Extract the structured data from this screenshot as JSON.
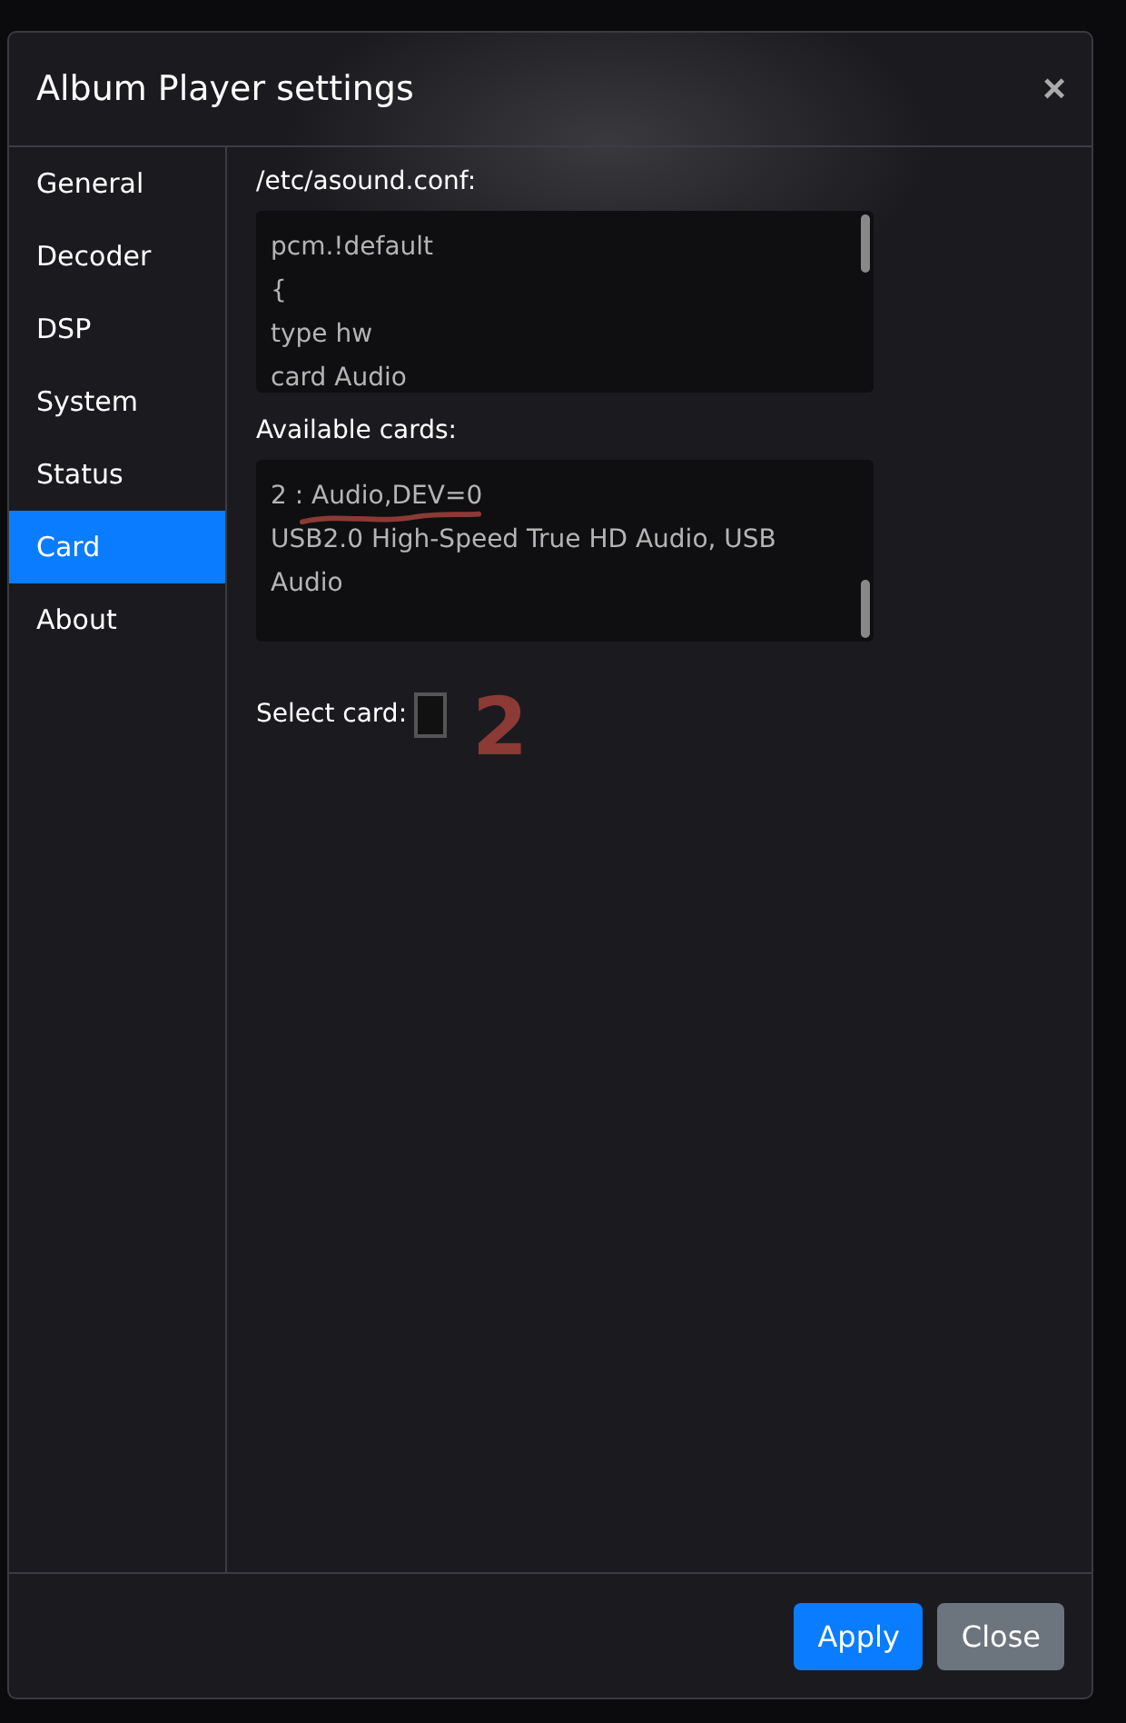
{
  "dialog": {
    "title": "Album Player settings",
    "close_glyph": "×"
  },
  "sidebar": {
    "items": [
      {
        "label": "General",
        "selected": false
      },
      {
        "label": "Decoder",
        "selected": false
      },
      {
        "label": "DSP",
        "selected": false
      },
      {
        "label": "System",
        "selected": false
      },
      {
        "label": "Status",
        "selected": false
      },
      {
        "label": "Card",
        "selected": true
      },
      {
        "label": "About",
        "selected": false
      }
    ]
  },
  "content": {
    "config_label": "/etc/asound.conf:",
    "config_lines": [
      "pcm.!default",
      "{",
      "type hw",
      "card Audio"
    ],
    "cards_label": "Available cards:",
    "cards_lines": [
      "2 : Audio,DEV=0",
      "USB2.0 High-Speed True HD Audio, USB Audio"
    ],
    "select_label": "Select card:",
    "annotation": {
      "text": "2",
      "underline": true
    }
  },
  "footer": {
    "buttons": [
      {
        "label": "Apply",
        "kind": "primary"
      },
      {
        "label": "Close",
        "kind": "secondary"
      }
    ]
  }
}
